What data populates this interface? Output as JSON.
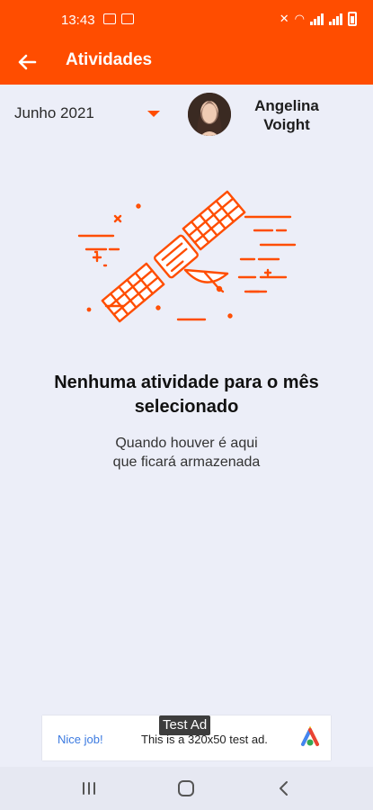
{
  "status_bar": {
    "time": "13:43"
  },
  "app_bar": {
    "title": "Atividades",
    "back_icon": "arrow-left-icon"
  },
  "filter": {
    "month": "Junho 2021",
    "dropdown_icon": "caret-down-icon"
  },
  "user": {
    "name_line1": "Angelina",
    "name_line2": "Voight"
  },
  "empty_state": {
    "title_line1": "Nenhuma atividade para o mês",
    "title_line2": "selecionado",
    "subtitle_line1": "Quando houver é aqui",
    "subtitle_line2": "que ficará armazenada",
    "illustration_icon": "satellite-icon"
  },
  "ad": {
    "badge": "Test Ad",
    "left_text": "Nice job!",
    "center_text": "This is a 320x50 test ad."
  },
  "colors": {
    "accent": "#ff4d00",
    "background": "#eceef8"
  }
}
